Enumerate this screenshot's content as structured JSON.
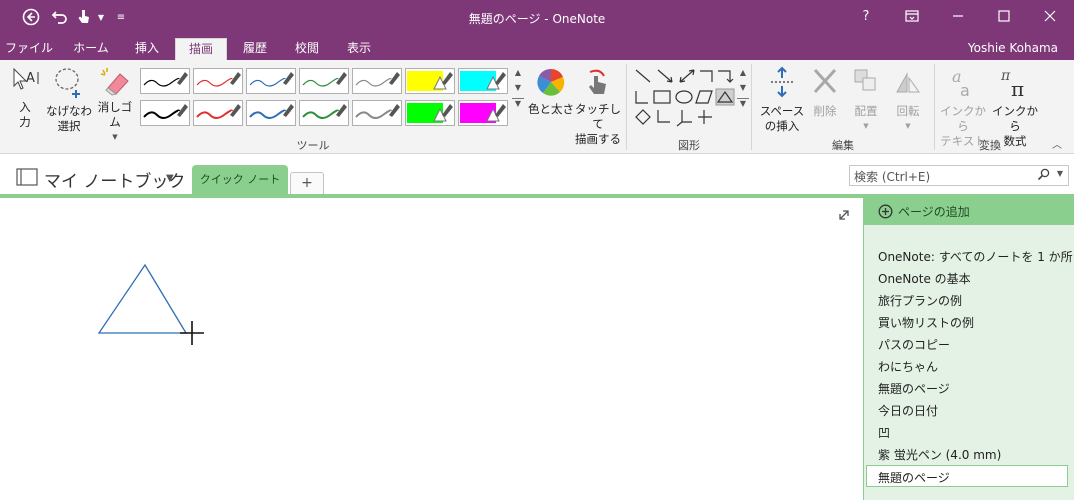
{
  "window": {
    "title": "無題のページ - OneNote",
    "help_label": "?",
    "colors": {
      "brand": "#7e3878",
      "section_green": "#8bcf8f",
      "page_panel": "#e3f2e4"
    }
  },
  "tabs": [
    {
      "label": "ファイル"
    },
    {
      "label": "ホーム"
    },
    {
      "label": "挿入"
    },
    {
      "label": "描画",
      "active": true
    },
    {
      "label": "履歴"
    },
    {
      "label": "校閲"
    },
    {
      "label": "表示"
    }
  ],
  "user": {
    "name": "Yoshie Kohama"
  },
  "ribbon": {
    "tools": {
      "input_label": "入力",
      "lasso_label1": "なげなわ",
      "lasso_label2": "選択",
      "eraser_label": "消しゴム",
      "group_label": "ツール",
      "color_thickness_label": "色と太さ",
      "touch_label1": "タッチして",
      "touch_label2": "描画する"
    },
    "pens_top": [
      {
        "color": "#000000",
        "kind": "pen"
      },
      {
        "color": "#e0302f",
        "kind": "pen"
      },
      {
        "color": "#2f6eb5",
        "kind": "pen"
      },
      {
        "color": "#2b8f3a",
        "kind": "pen"
      },
      {
        "color": "#888888",
        "kind": "pen"
      },
      {
        "color": "#ffff00",
        "kind": "highlighter"
      },
      {
        "color": "#00ffff",
        "kind": "highlighter"
      }
    ],
    "pens_bottom": [
      {
        "color": "#000000",
        "kind": "pen"
      },
      {
        "color": "#e0302f",
        "kind": "pen"
      },
      {
        "color": "#2f6eb5",
        "kind": "pen"
      },
      {
        "color": "#2b8f3a",
        "kind": "pen"
      },
      {
        "color": "#888888",
        "kind": "pen"
      },
      {
        "color": "#00ff00",
        "kind": "highlighter"
      },
      {
        "color": "#ff00ff",
        "kind": "highlighter"
      }
    ],
    "shapes": {
      "group_label": "図形"
    },
    "edit": {
      "space_label1": "スペース",
      "space_label2": "の挿入",
      "delete_label": "削除",
      "arrange_label": "配置",
      "rotate_label": "回転",
      "group_label": "編集"
    },
    "convert": {
      "ink_text_label1": "インクから",
      "ink_text_label2": "テキスト",
      "ink_math_label1": "インクから",
      "ink_math_label2": "数式",
      "group_label": "変換"
    }
  },
  "notebook": {
    "name": "マイ ノートブック",
    "section": "クイック ノート",
    "add_section": "+"
  },
  "search": {
    "placeholder": "検索 (Ctrl+E)"
  },
  "pages": {
    "add_label": "ページの追加",
    "items": [
      "OneNote: すべてのノートを 1 か所",
      "OneNote の基本",
      "旅行プランの例",
      "買い物リストの例",
      "パスのコピー",
      "わにちゃん",
      "無題のページ",
      "今日の日付",
      "凹",
      "紫 蛍光ペン (4.0 mm)"
    ],
    "current": "無題のページ"
  }
}
